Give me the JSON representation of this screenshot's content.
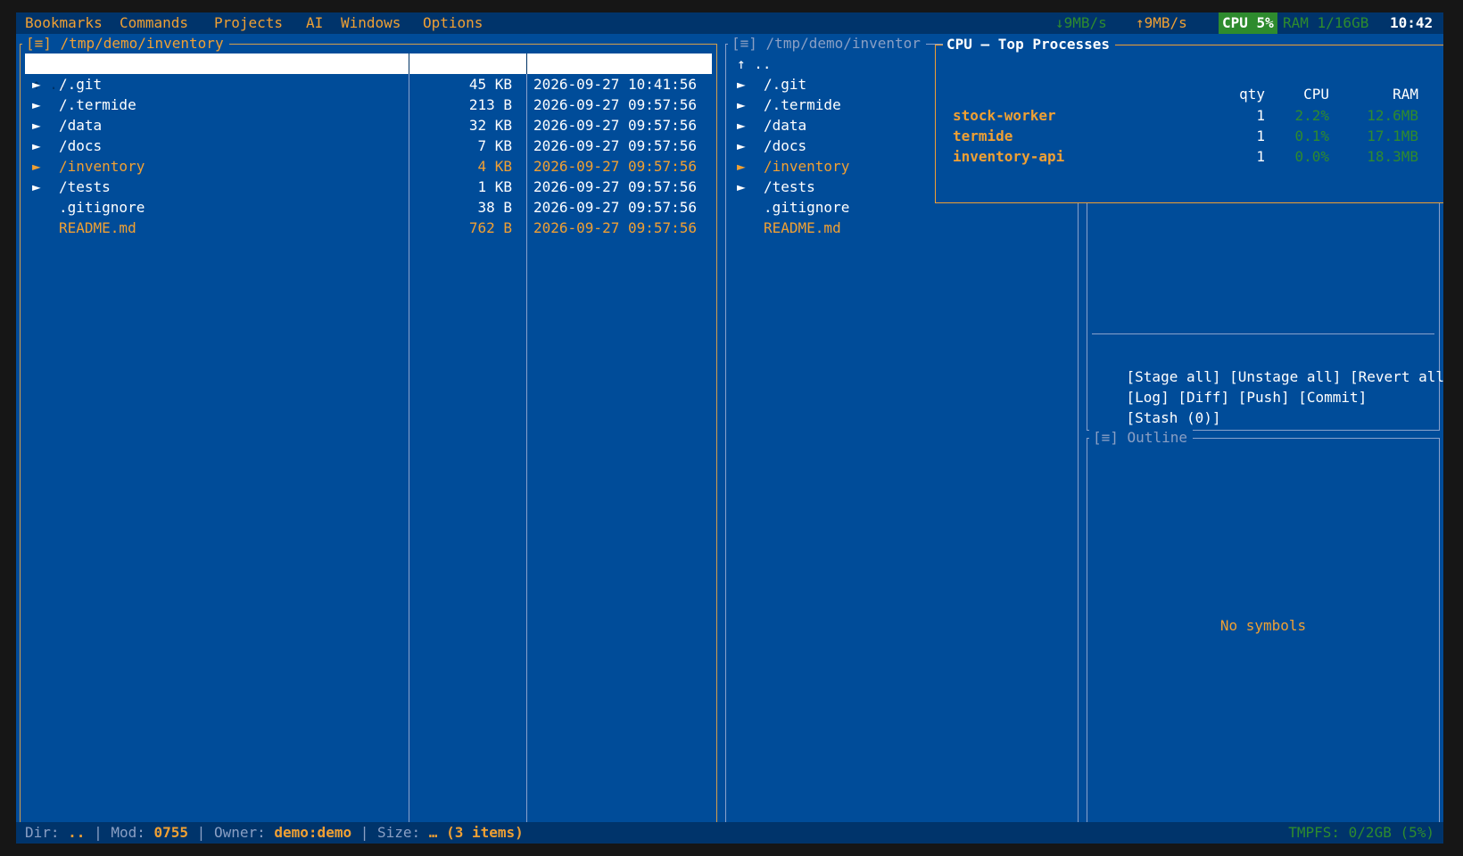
{
  "menubar": {
    "items": [
      "Bookmarks",
      "Commands",
      "Projects",
      "AI",
      "Windows",
      "Options"
    ],
    "net_down": "↓9MB/s",
    "net_up": "↑9MB/s",
    "cpu": "CPU 5%",
    "ram": "RAM 1/16GB",
    "clock": "10:42"
  },
  "left_panel": {
    "menu_glyph": "[≡]",
    "path": "/tmp/demo/inventory",
    "parent": "↑ ..",
    "rows": [
      {
        "arrow": "►",
        "name": "/.git",
        "size": "45 KB",
        "date": "2026-09-27 10:41:56",
        "highlight": false
      },
      {
        "arrow": "►",
        "name": "/.termide",
        "size": "213 B",
        "date": "2026-09-27 09:57:56",
        "highlight": false
      },
      {
        "arrow": "►",
        "name": "/data",
        "size": "32 KB",
        "date": "2026-09-27 09:57:56",
        "highlight": false
      },
      {
        "arrow": "►",
        "name": "/docs",
        "size": "7 KB",
        "date": "2026-09-27 09:57:56",
        "highlight": false
      },
      {
        "arrow": "►",
        "name": "/inventory",
        "size": "4 KB",
        "date": "2026-09-27 09:57:56",
        "highlight": true
      },
      {
        "arrow": "►",
        "name": "/tests",
        "size": "1 KB",
        "date": "2026-09-27 09:57:56",
        "highlight": false
      },
      {
        "arrow": "",
        "name": ".gitignore",
        "size": "38 B",
        "date": "2026-09-27 09:57:56",
        "highlight": false
      },
      {
        "arrow": "",
        "name": "README.md",
        "size": "762 B",
        "date": "2026-09-27 09:57:56",
        "highlight": true
      }
    ]
  },
  "mid_panel": {
    "menu_glyph": "[≡]",
    "path": "/tmp/demo/inventor",
    "parent": "↑ ..",
    "rows": [
      {
        "arrow": "►",
        "name": "/.git",
        "highlight": false
      },
      {
        "arrow": "►",
        "name": "/.termide",
        "highlight": false
      },
      {
        "arrow": "►",
        "name": "/data",
        "highlight": false
      },
      {
        "arrow": "►",
        "name": "/docs",
        "highlight": false
      },
      {
        "arrow": "►",
        "name": "/inventory",
        "highlight": true
      },
      {
        "arrow": "►",
        "name": "/tests",
        "highlight": false
      },
      {
        "arrow": "",
        "name": ".gitignore",
        "highlight": false
      },
      {
        "arrow": "",
        "name": "README.md",
        "highlight": true
      }
    ]
  },
  "cpu_popup": {
    "title": "CPU — Top Processes",
    "headers": {
      "qty": "qty",
      "cpu": "CPU",
      "ram": "RAM"
    },
    "processes": [
      {
        "name": "stock-worker",
        "qty": "1",
        "cpu": "2.2%",
        "ram": "12.6MB"
      },
      {
        "name": "termide",
        "qty": "1",
        "cpu": "0.1%",
        "ram": "17.1MB"
      },
      {
        "name": "inventory-api",
        "qty": "1",
        "cpu": "0.0%",
        "ram": "18.3MB"
      }
    ]
  },
  "git_panel": {
    "buttons_row1": [
      "[Stage all]",
      "[Unstage all]",
      "[Revert all]"
    ],
    "buttons_row2": [
      "[Log]",
      "[Diff]",
      "[Push]",
      "[Commit]"
    ],
    "buttons_row3": [
      "[Stash (0)]"
    ]
  },
  "outline_panel": {
    "menu_glyph": "[≡]",
    "title": "Outline",
    "empty_text": "No symbols"
  },
  "statusbar": {
    "dir_label": "Dir: ",
    "dir_value": "..",
    "sep1": " | ",
    "mod_label": "Mod: ",
    "mod_value": "0755",
    "sep2": " | ",
    "owner_label": "Owner: ",
    "owner_value": "demo:demo",
    "sep3": " | ",
    "size_label": "Size: ",
    "size_value": "… (3 items)",
    "tmpfs": "TMPFS: 0/2GB (5%)"
  },
  "colors": {
    "background": "#004c99",
    "accent": "#f0a033",
    "bar": "#00346b",
    "cpu_badge": "#2e8b2e"
  }
}
